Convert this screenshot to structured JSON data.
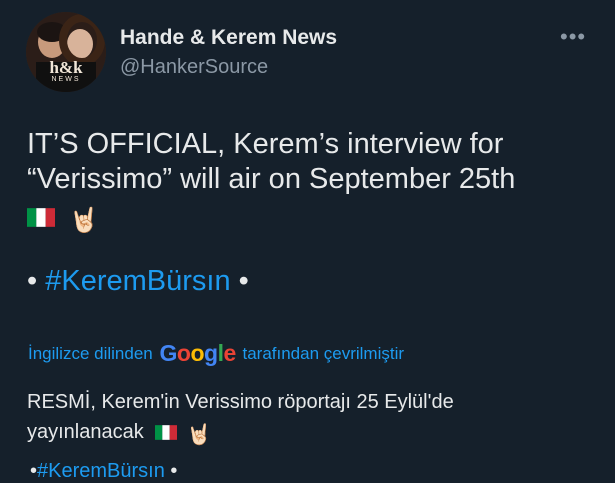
{
  "author": {
    "name": "Hande & Kerem News",
    "handle": "@HankerSource",
    "avatar_logo": "h&k",
    "avatar_sub": "NEWS"
  },
  "more_icon": "•••",
  "tweet": {
    "line1": "IT’S OFFICIAL, Kerem’s interview for",
    "line2": "“Verissimo” will air on September 25th",
    "emoji_hand": "🤘🏻",
    "bullet_left": "• ",
    "hashtag": "#KeremBürsın",
    "bullet_right": " •"
  },
  "translation_bar": {
    "prefix": "İngilizce dilinden",
    "google": [
      "G",
      "o",
      "o",
      "g",
      "l",
      "e"
    ],
    "suffix": "tarafından çevrilmiştir"
  },
  "translation": {
    "line1": "RESMİ, Kerem'in Verissimo röportajı 25 Eylül'de",
    "line2": "yayınlanacak",
    "emoji_hand": "🤘🏻",
    "bullet_left": "•",
    "hashtag": "#KeremBürsın",
    "bullet_right": " •"
  },
  "colors": {
    "background": "#15202b",
    "link": "#1d9bf0",
    "google_blue": "#4285f4",
    "google_red": "#ea4335",
    "google_yellow": "#fbbc05",
    "google_green": "#34a853"
  }
}
